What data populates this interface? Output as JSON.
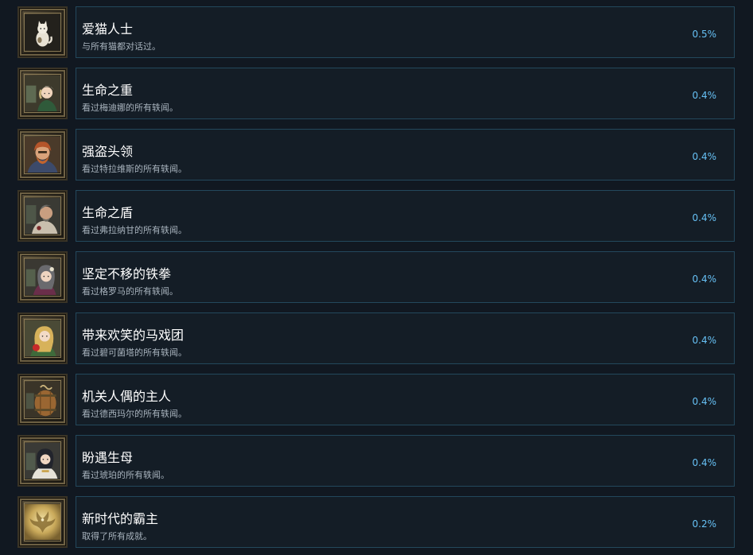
{
  "achievements": [
    {
      "title": "爱猫人士",
      "description": "与所有猫都对话过。",
      "percent": "0.5%",
      "icon": "white-cat-icon"
    },
    {
      "title": "生命之重",
      "description": "看过梅迪娜的所有轶闻。",
      "percent": "0.4%",
      "icon": "medina-portrait-icon"
    },
    {
      "title": "强盗头领",
      "description": "看过特拉维斯的所有轶闻。",
      "percent": "0.4%",
      "icon": "travis-portrait-icon"
    },
    {
      "title": "生命之盾",
      "description": "看过弗拉纳甘的所有轶闻。",
      "percent": "0.4%",
      "icon": "flanagan-portrait-icon"
    },
    {
      "title": "坚定不移的铁拳",
      "description": "看过格罗马的所有轶闻。",
      "percent": "0.4%",
      "icon": "groma-portrait-icon"
    },
    {
      "title": "带来欢笑的马戏团",
      "description": "看过碧可菌塔的所有轶闻。",
      "percent": "0.4%",
      "icon": "circus-girl-portrait-icon"
    },
    {
      "title": "机关人偶的主人",
      "description": "看过德西玛尔的所有轶闻。",
      "percent": "0.4%",
      "icon": "barrel-puppet-icon"
    },
    {
      "title": "盼遇生母",
      "description": "看过琥珀的所有轶闻。",
      "percent": "0.4%",
      "icon": "amber-portrait-icon"
    },
    {
      "title": "新时代的霸主",
      "description": "取得了所有成就。",
      "percent": "0.2%",
      "icon": "golden-eagle-emblem-icon"
    }
  ]
}
